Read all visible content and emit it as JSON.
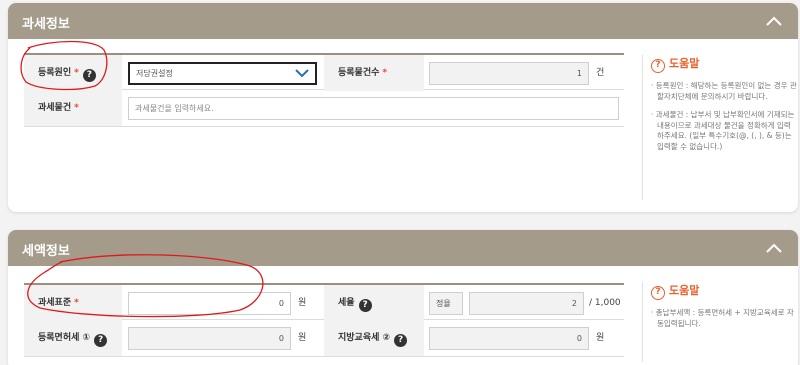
{
  "tax_info": {
    "title": "과세정보",
    "fields": {
      "reason_label": "등록원인",
      "req_mark": "*",
      "reason_value": "저당권설정",
      "count_label": "등록물건수",
      "count_value": "1",
      "count_unit": "건",
      "object_label": "과세물건",
      "object_placeholder": "과세물건을 입력하세요."
    },
    "help": {
      "title": "도움말",
      "items": [
        "· 등록원인 : 해당하는 등록원인이 없는 경우 관할자치단체에 문의하시기 바랍니다.",
        "· 과세물건 : 납부서 및 납부확인서에 기재되는 내용이므로 과세대상 물건을 정확하게 입력 하주세요. (일부 특수기호(@, (, ), & 등)는 입력할 수 없습니다.)"
      ]
    }
  },
  "tax_amount": {
    "title": "세액정보",
    "fields": {
      "base_label": "과세표준",
      "req_mark": "*",
      "base_value": "0",
      "won": "원",
      "rate_label": "세율",
      "rate_type": "정율",
      "rate_value": "2",
      "rate_unit": "/ 1,000",
      "reg_tax_label": "등록면허세 ①",
      "reg_tax_value": "0",
      "edu_tax_label": "지방교육세 ②",
      "edu_tax_value": "0"
    },
    "help": {
      "title": "도움말",
      "items": [
        "· 총납부세액 : 등록면허세 + 지방교육세로 자동입력됩니다."
      ]
    }
  },
  "icons": {
    "question": "?",
    "help": "?"
  },
  "colors": {
    "header": "#a59b8a",
    "required": "#e8423b",
    "help_accent": "#e8622b",
    "annotation": "#e0191b"
  }
}
